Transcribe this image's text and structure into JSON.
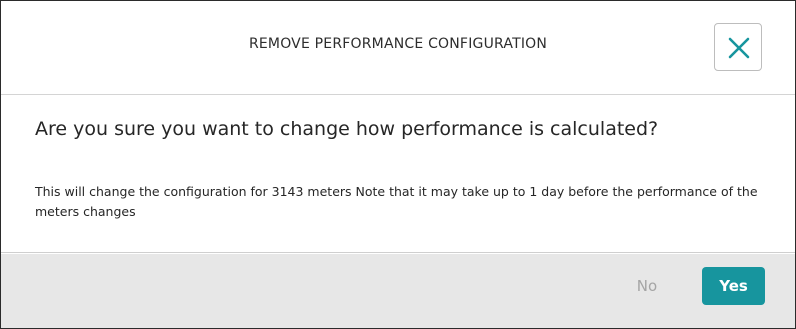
{
  "dialog": {
    "title": "REMOVE PERFORMANCE CONFIGURATION",
    "close_icon": "close-icon",
    "question": "Are you sure you want to change how performance is calculated?",
    "details": "This will change the configuration for 3143 meters Note that it may take up to 1 day before the performance of the meters changes",
    "no_label": "No",
    "yes_label": "Yes"
  },
  "colors": {
    "accent": "#17959e",
    "footer_bg": "#e7e7e7",
    "disabled_text": "#a5a5a5"
  }
}
